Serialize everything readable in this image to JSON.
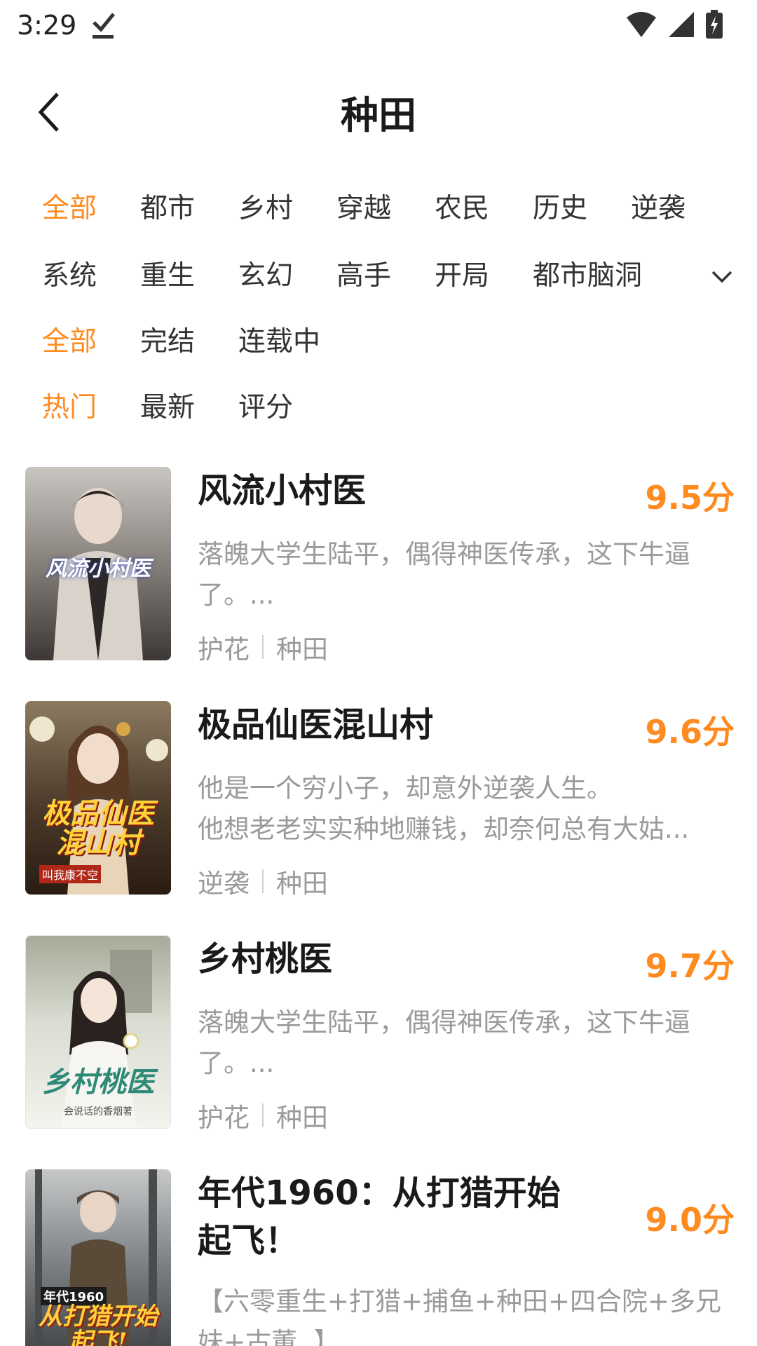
{
  "status": {
    "time": "3:29"
  },
  "header": {
    "title": "种田"
  },
  "filters": {
    "category_row1": [
      "全部",
      "都市",
      "乡村",
      "穿越",
      "农民",
      "历史",
      "逆袭"
    ],
    "category_row2": [
      "系统",
      "重生",
      "玄幻",
      "高手",
      "开局",
      "都市脑洞"
    ],
    "status_row": [
      "全部",
      "完结",
      "连载中"
    ],
    "sort_row": [
      "热门",
      "最新",
      "评分"
    ]
  },
  "books": [
    {
      "title": "风流小村医",
      "score": "9.5分",
      "description": "落魄大学生陆平，偶得神医传承，这下牛逼了。...",
      "tags": [
        "护花",
        "种田"
      ],
      "cover_text": "风流小村医"
    },
    {
      "title": "极品仙医混山村",
      "score": "9.6分",
      "description": "他是一个穷小子，却意外逆袭人生。\n他想老老实实种地赚钱，却奈何总有大姑...",
      "tags": [
        "逆袭",
        "种田"
      ],
      "cover_text": "极品仙医混山村",
      "cover_author": "叫我康不空"
    },
    {
      "title": "乡村桃医",
      "score": "9.7分",
      "description": "落魄大学生陆平，偶得神医传承，这下牛逼了。...",
      "tags": [
        "护花",
        "种田"
      ],
      "cover_text": "乡村桃医",
      "cover_author": "会说话的香烟著"
    },
    {
      "title": "年代1960：从打猎开始起飞！",
      "score": "9.0分",
      "description": "【六零重生+打猎+捕鱼+种田+四合院+多兄妹+古董..】...",
      "tags": [],
      "cover_text": "从打猎开始起飞!",
      "cover_badge": "年代1960"
    }
  ]
}
